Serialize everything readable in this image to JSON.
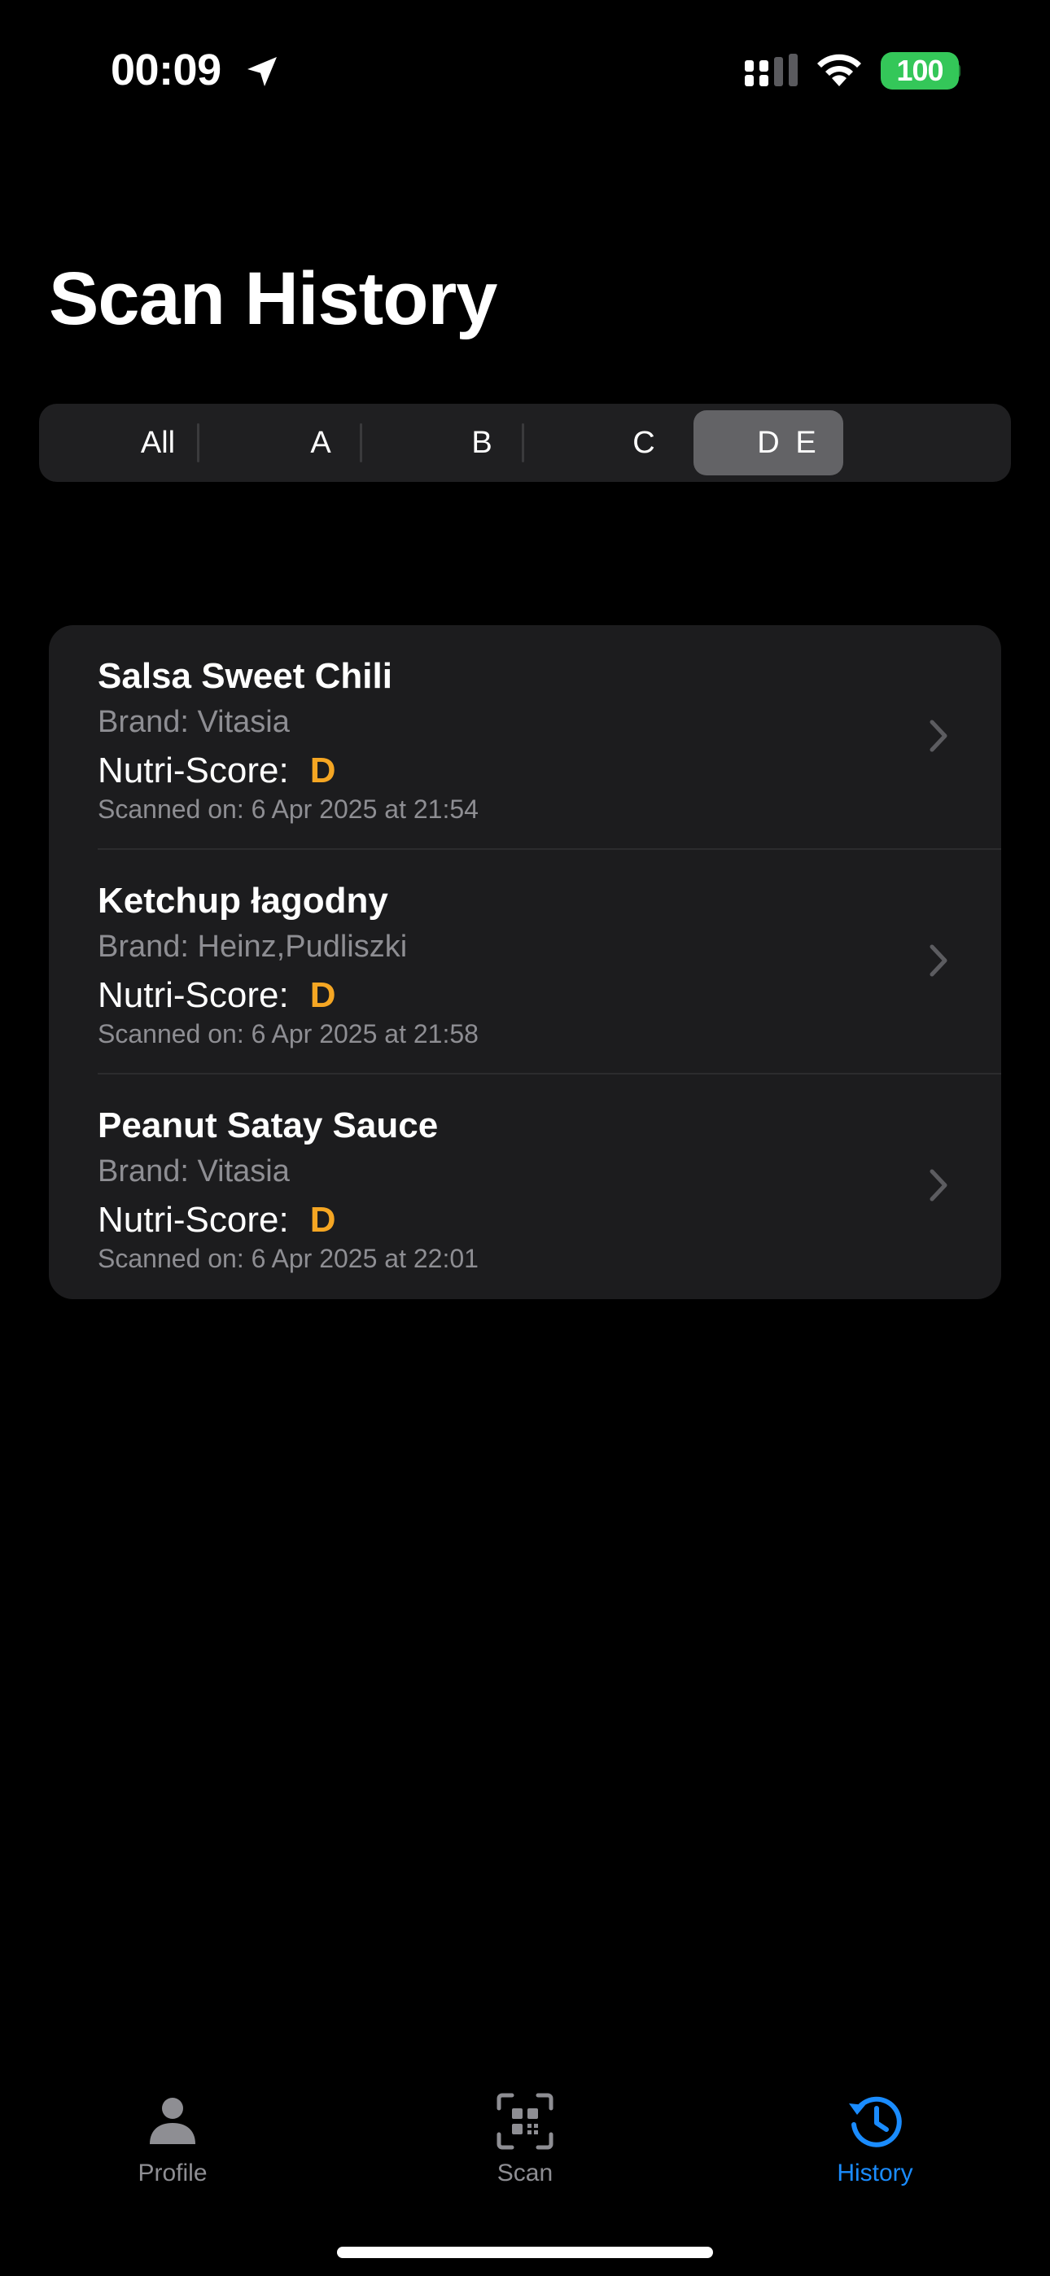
{
  "status_bar": {
    "time": "00:09",
    "battery": "100"
  },
  "page": {
    "title": "Scan History"
  },
  "filter": {
    "segments": [
      "All",
      "A",
      "B",
      "C",
      "D",
      "E"
    ],
    "selected": "D"
  },
  "history": {
    "items": [
      {
        "name": "Salsa Sweet Chili",
        "brand": "Brand: Vitasia",
        "score_label": "Nutri-Score:",
        "score_value": "D",
        "scanned": "Scanned on: 6 Apr 2025 at 21:54"
      },
      {
        "name": "Ketchup łagodny",
        "brand": "Brand: Heinz,Pudliszki",
        "score_label": "Nutri-Score:",
        "score_value": "D",
        "scanned": "Scanned on: 6 Apr 2025 at 21:58"
      },
      {
        "name": "Peanut Satay Sauce",
        "brand": "Brand: Vitasia",
        "score_label": "Nutri-Score:",
        "score_value": "D",
        "scanned": "Scanned on: 6 Apr 2025 at 22:01"
      }
    ]
  },
  "tab_bar": {
    "tabs": [
      {
        "label": "Profile",
        "icon": "person-icon",
        "active": false
      },
      {
        "label": "Scan",
        "icon": "qr-scan-icon",
        "active": false
      },
      {
        "label": "History",
        "icon": "history-icon",
        "active": true
      }
    ]
  },
  "colors": {
    "background": "#000000",
    "card": "#1c1c1e",
    "selected_segment": "#636366",
    "score_d": "#f5a623",
    "accent": "#1a8cff",
    "battery": "#34c759",
    "secondary_text": "#8e8e93"
  }
}
